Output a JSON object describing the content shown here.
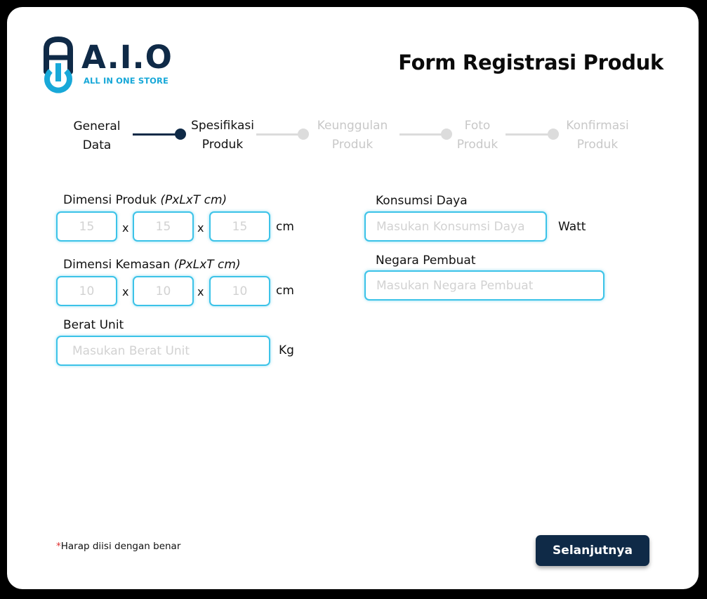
{
  "brand": {
    "title": "A.I.O",
    "subtitle": "ALL IN ONE STORE",
    "primary_color": "#0f2a47",
    "accent_color": "#18a8d8"
  },
  "page_title": "Form Registrasi Produk",
  "stepper": {
    "steps": [
      {
        "line1": "General",
        "line2": "Data",
        "state": "done"
      },
      {
        "line1": "Spesifikasi",
        "line2": "Produk",
        "state": "active"
      },
      {
        "line1": "Keunggulan",
        "line2": "Produk",
        "state": "todo"
      },
      {
        "line1": "Foto",
        "line2": "Produk",
        "state": "todo"
      },
      {
        "line1": "Konfirmasi",
        "line2": "Produk",
        "state": "todo"
      }
    ]
  },
  "form": {
    "dimensi_produk": {
      "label": "Dimensi Produk ",
      "hint": "(PxLxT cm)",
      "placeholders": [
        "15",
        "15",
        "15"
      ],
      "separator": "x",
      "unit": "cm"
    },
    "dimensi_kemasan": {
      "label": "Dimensi Kemasan ",
      "hint": "(PxLxT cm)",
      "placeholders": [
        "10",
        "10",
        "10"
      ],
      "separator": "x",
      "unit": "cm"
    },
    "berat_unit": {
      "label": "Berat Unit",
      "placeholder": "Masukan Berat Unit",
      "unit": "Kg"
    },
    "konsumsi_daya": {
      "label": "Konsumsi Daya",
      "placeholder": "Masukan Konsumsi Daya",
      "unit": "Watt"
    },
    "negara_pembuat": {
      "label": "Negara Pembuat",
      "placeholder": "Masukan Negara Pembuat"
    }
  },
  "footer": {
    "note_star": "*",
    "note": "Harap diisi dengan benar",
    "next_label": "Selanjutnya"
  },
  "colors": {
    "input_border": "#3cc3e8",
    "step_done": "#0f2a47",
    "step_todo": "#dcdcdc"
  }
}
